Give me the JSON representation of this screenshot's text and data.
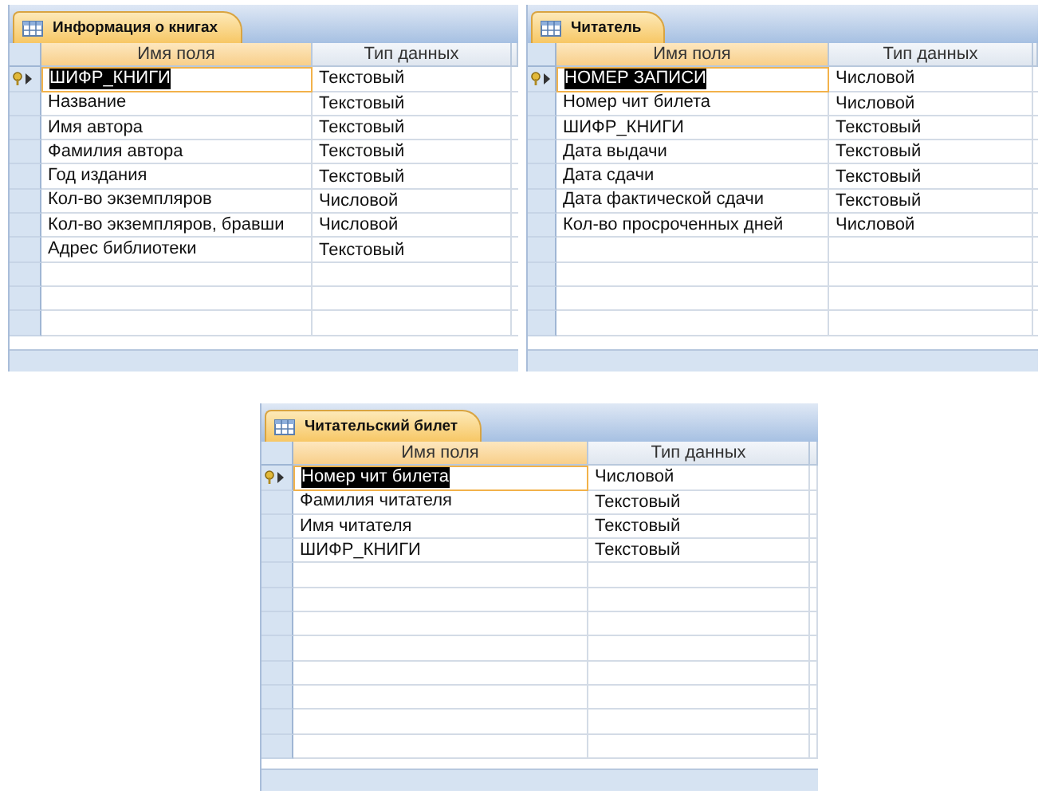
{
  "tables": [
    {
      "title": "Информация о книгах",
      "columns": [
        "Имя поля",
        "Тип данных"
      ],
      "rows": [
        {
          "field": "ШИФР_КНИГИ",
          "type": "Текстовый",
          "primary_key": true,
          "selected": true
        },
        {
          "field": "Название",
          "type": "Текстовый",
          "primary_key": false,
          "selected": false
        },
        {
          "field": "Имя автора",
          "type": "Текстовый",
          "primary_key": false,
          "selected": false
        },
        {
          "field": "Фамилия автора",
          "type": "Текстовый",
          "primary_key": false,
          "selected": false
        },
        {
          "field": "Год издания",
          "type": "Текстовый",
          "primary_key": false,
          "selected": false
        },
        {
          "field": "Кол-во экземпляров",
          "type": "Числовой",
          "primary_key": false,
          "selected": false
        },
        {
          "field": "Кол-во экземпляров, бравши",
          "type": "Числовой",
          "primary_key": false,
          "selected": false
        },
        {
          "field": "Адрес библиотеки",
          "type": "Текстовый",
          "primary_key": false,
          "selected": false
        }
      ]
    },
    {
      "title": "Читатель",
      "columns": [
        "Имя поля",
        "Тип данных"
      ],
      "rows": [
        {
          "field": "НОМЕР ЗАПИСИ",
          "type": "Числовой",
          "primary_key": true,
          "selected": true
        },
        {
          "field": "Номер чит билета",
          "type": "Числовой",
          "primary_key": false,
          "selected": false
        },
        {
          "field": "ШИФР_КНИГИ",
          "type": "Текстовый",
          "primary_key": false,
          "selected": false
        },
        {
          "field": "Дата выдачи",
          "type": "Текстовый",
          "primary_key": false,
          "selected": false
        },
        {
          "field": "Дата сдачи",
          "type": "Текстовый",
          "primary_key": false,
          "selected": false
        },
        {
          "field": "Дата фактической сдачи",
          "type": "Текстовый",
          "primary_key": false,
          "selected": false
        },
        {
          "field": "Кол-во просроченных дней",
          "type": "Числовой",
          "primary_key": false,
          "selected": false
        }
      ]
    },
    {
      "title": "Читательский билет",
      "columns": [
        "Имя поля",
        "Тип данных"
      ],
      "rows": [
        {
          "field": "Номер чит билета",
          "type": "Числовой",
          "primary_key": true,
          "selected": true
        },
        {
          "field": "Фамилия читателя",
          "type": "Текстовый",
          "primary_key": false,
          "selected": false
        },
        {
          "field": "Имя читателя",
          "type": "Текстовый",
          "primary_key": false,
          "selected": false
        },
        {
          "field": "ШИФР_КНИГИ",
          "type": "Текстовый",
          "primary_key": false,
          "selected": false
        }
      ]
    }
  ]
}
